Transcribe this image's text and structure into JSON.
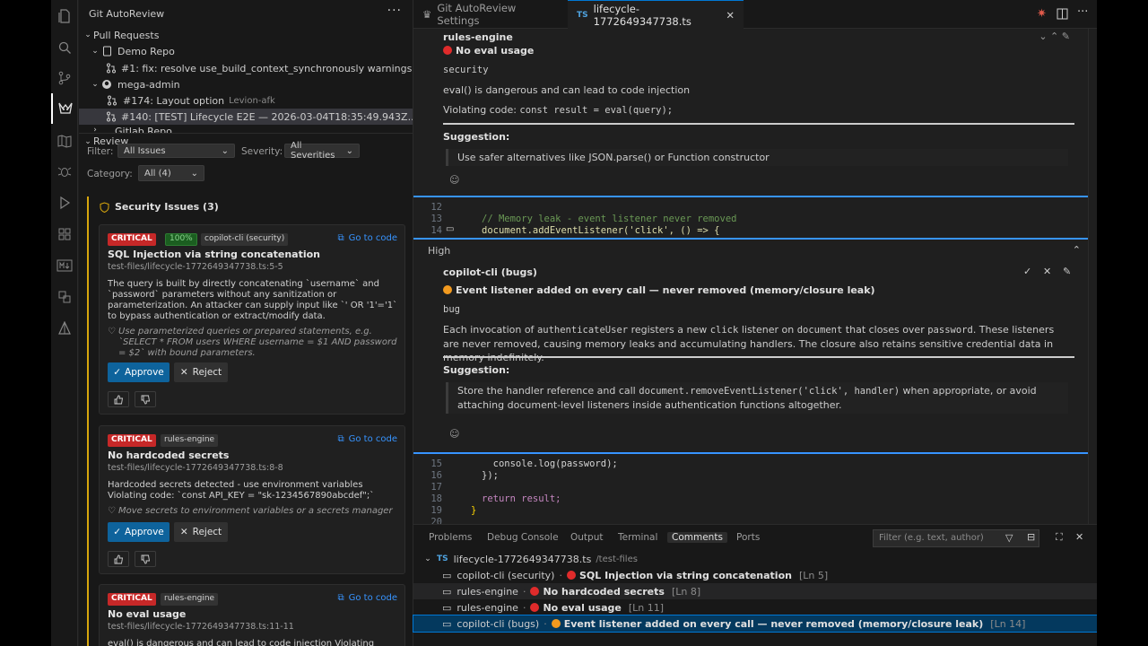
{
  "sidebar": {
    "title": "Git AutoReview",
    "tree": {
      "pull_requests": "Pull Requests",
      "demo_repo": "Demo Repo",
      "pr1": "#1: fix: resolve use_build_context_synchronously warnings...",
      "mega_admin": "mega-admin",
      "pr174": "#174: Layout option",
      "pr174_author": "Levion-afk",
      "pr140": "#140: [TEST] Lifecycle E2E — 2026-03-04T18:35:49.943Z...",
      "gitlab_repo": "Gitlab Repo"
    },
    "review": {
      "header": "Review",
      "filter_label": "Filter:",
      "filter_value": "All Issues",
      "severity_label": "Severity:",
      "severity_value": "All Severities",
      "category_label": "Category:",
      "category_value": "All (4)",
      "section_title": "Security Issues (3)",
      "go_to_code": "Go to code",
      "approve": "Approve",
      "reject": "Reject",
      "cards": [
        {
          "severity": "CRITICAL",
          "confidence": "100%",
          "source": "copilot-cli (security)",
          "title": "SQL Injection via string concatenation",
          "file": "test-files/lifecycle-1772649347738.ts:5-5",
          "description": "The query is built by directly concatenating `username` and `password` parameters without any sanitization or parameterization. An attacker can supply input like `' OR '1'='1` to bypass authentication or extract/modify data.",
          "suggestion": "Use parameterized queries or prepared statements, e.g. `SELECT * FROM users WHERE username = $1 AND password = $2` with bound parameters."
        },
        {
          "severity": "CRITICAL",
          "source": "rules-engine",
          "title": "No hardcoded secrets",
          "file": "test-files/lifecycle-1772649347738.ts:8-8",
          "description": "Hardcoded secrets detected - use environment variables Violating code: `const API_KEY = \"sk-1234567890abcdef\";`",
          "suggestion": "Move secrets to environment variables or a secrets manager"
        },
        {
          "severity": "CRITICAL",
          "source": "rules-engine",
          "title": "No eval usage",
          "file": "test-files/lifecycle-1772649347738.ts:11-11",
          "description": "eval() is dangerous and can lead to code injection Violating code:"
        }
      ]
    }
  },
  "tabs": [
    {
      "label": "Git AutoReview Settings"
    },
    {
      "label": "lifecycle-1772649347738.ts",
      "lang": "TS"
    }
  ],
  "editor": {
    "zone1": {
      "author_cut": "rules-engine",
      "title": "No eval usage",
      "category": "security",
      "message": "eval() is dangerous and can lead to code injection",
      "violating_label": "Violating code:",
      "violating_code": "const result = eval(query);",
      "suggestion_label": "Suggestion:",
      "suggestion": "Use safer alternatives like JSON.parse() or Function constructor"
    },
    "code_block_1": [
      {
        "ln": "12",
        "text": ""
      },
      {
        "ln": "13",
        "text": "// Memory leak - event listener never removed"
      },
      {
        "ln": "14",
        "text": "document.addEventListener('click', () => {"
      }
    ],
    "zone2": {
      "severity": "High",
      "author": "copilot-cli (bugs)",
      "title": "Event listener added on every call — never removed (memory/closure leak)",
      "category": "bug",
      "msg_1": "Each invocation of",
      "msg_code_1": "authenticateUser",
      "msg_2": "registers a new",
      "msg_code_2": "click",
      "msg_3": "listener on",
      "msg_code_3": "document",
      "msg_4": "that closes over",
      "msg_code_4": "password",
      "msg_5": ". These listeners are never removed, causing memory leaks and accumulating handlers. The closure also retains sensitive credential data in memory indefinitely.",
      "suggestion_label": "Suggestion:",
      "sugg_1": "Store the handler reference and call",
      "sugg_code": "document.removeEventListener('click', handler)",
      "sugg_2": "when appropriate, or avoid attaching document-level listeners inside authentication functions altogether."
    },
    "code_block_2": [
      {
        "ln": "15",
        "text": "  console.log(password);"
      },
      {
        "ln": "16",
        "text": "});"
      },
      {
        "ln": "17",
        "text": ""
      },
      {
        "ln": "18",
        "text": "return result;"
      },
      {
        "ln": "19",
        "text": "}"
      },
      {
        "ln": "20",
        "text": ""
      }
    ]
  },
  "panel": {
    "tabs": [
      "Problems",
      "Debug Console",
      "Output",
      "Terminal",
      "Comments",
      "Ports"
    ],
    "filter_placeholder": "Filter (e.g. text, author)",
    "file": "lifecycle-1772649347738.ts",
    "file_path": "/test-files",
    "comments": [
      {
        "author": "copilot-cli (security)",
        "sev": "red",
        "title": "SQL Injection via string concatenation",
        "ln": "[Ln 5]"
      },
      {
        "author": "rules-engine",
        "sev": "red",
        "title": "No hardcoded secrets",
        "ln": "[Ln 8]"
      },
      {
        "author": "rules-engine",
        "sev": "red",
        "title": "No eval usage",
        "ln": "[Ln 11]"
      },
      {
        "author": "copilot-cli (bugs)",
        "sev": "orange",
        "title": "Event listener added on every call — never removed (memory/closure leak)",
        "ln": "[Ln 14]"
      }
    ]
  },
  "colors": {
    "accent": "#0078d4",
    "critical": "#c62828",
    "warning": "#d7a60d"
  }
}
